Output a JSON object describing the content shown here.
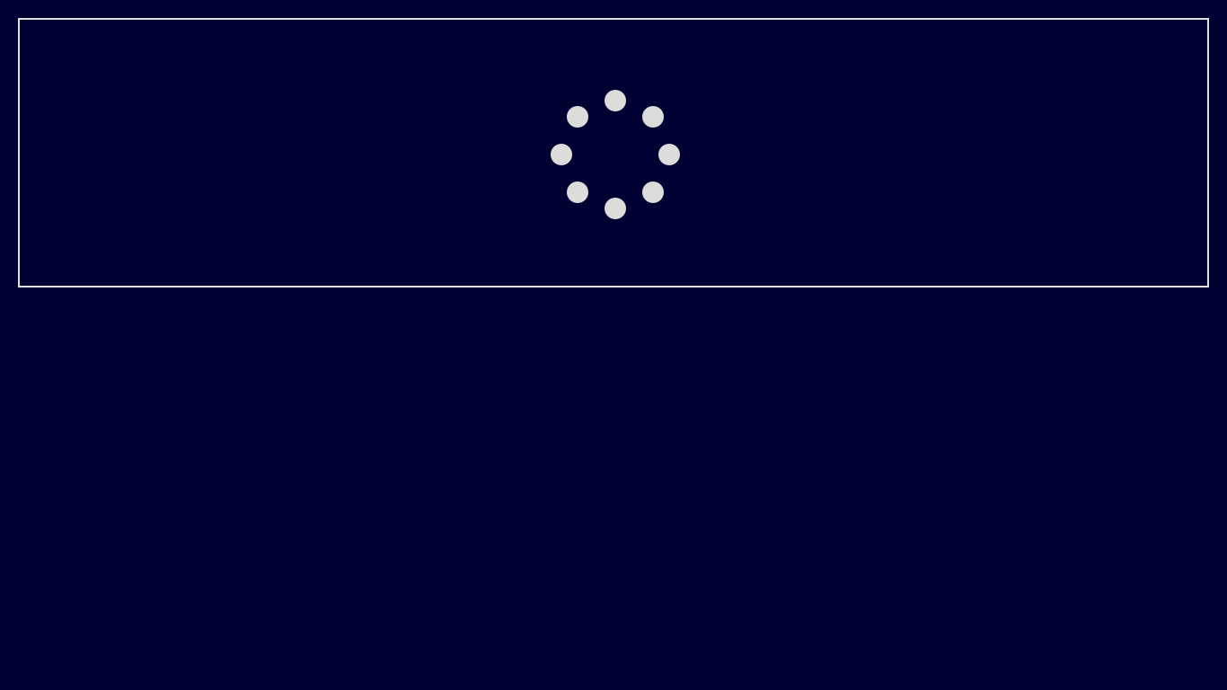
{
  "colors": {
    "background": "#000033",
    "panel_border": "#e0e0e0",
    "spinner_dot": "#dcdcdc"
  },
  "spinner": {
    "icon": "loading-spinner-icon",
    "dot_count": 8
  }
}
